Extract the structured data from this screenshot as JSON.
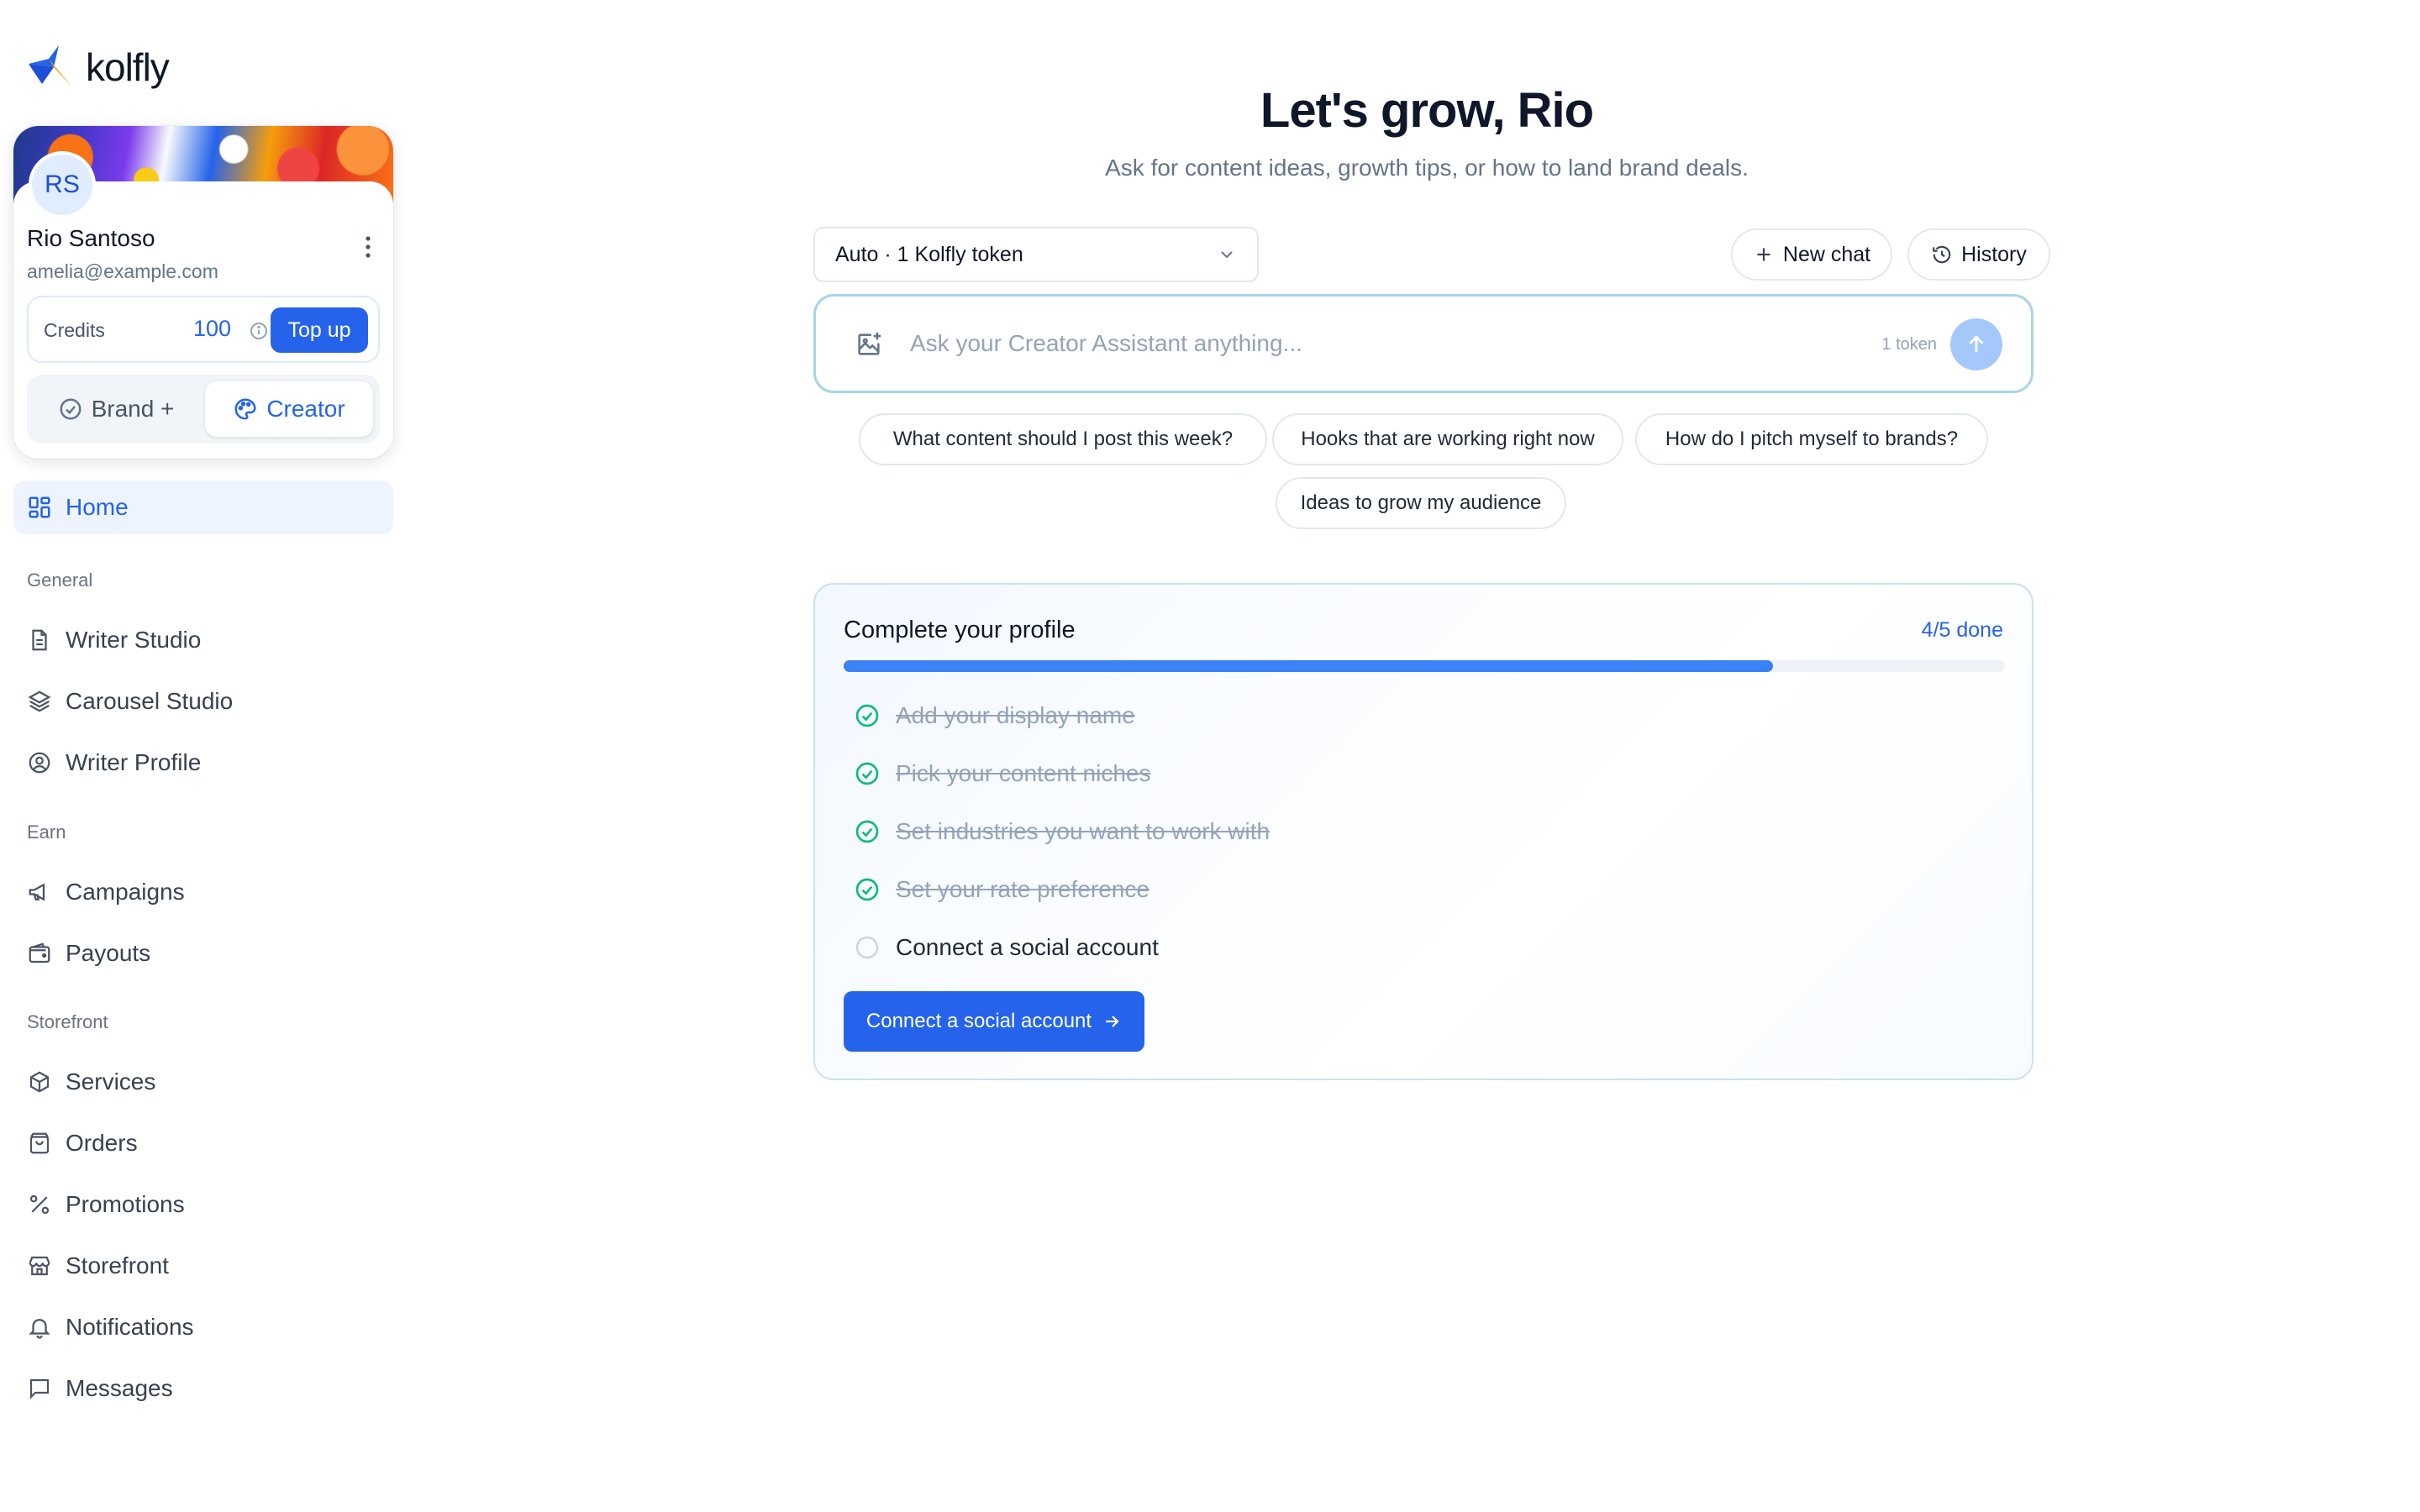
{
  "app": {
    "logo_text": "kolfly"
  },
  "user": {
    "initials": "RS",
    "name": "Rio Santoso",
    "email": "amelia@example.com"
  },
  "credits": {
    "label": "Credits",
    "value": "100",
    "topup_label": "Top up"
  },
  "mode_switch": {
    "brand_label": "Brand +",
    "creator_label": "Creator",
    "active": "creator"
  },
  "nav": {
    "home": "Home",
    "sections": [
      {
        "label": "General",
        "items": [
          "Writer Studio",
          "Carousel Studio",
          "Writer Profile"
        ]
      },
      {
        "label": "Earn",
        "items": [
          "Campaigns",
          "Payouts"
        ]
      },
      {
        "label": "Storefront",
        "items": [
          "Services",
          "Orders",
          "Promotions",
          "Storefront",
          "Notifications",
          "Messages"
        ]
      }
    ]
  },
  "main": {
    "title": "Let's grow, Rio",
    "subtitle": "Ask for content ideas, growth tips, or how to land brand deals.",
    "model_select": "Auto · 1 Kolfly token",
    "new_chat_label": "New chat",
    "history_label": "History",
    "chat_placeholder": "Ask your Creator Assistant anything...",
    "token_hint": "1 token",
    "suggestions": [
      "What content should I post this week?",
      "Hooks that are working right now",
      "How do I pitch myself to brands?",
      "Ideas to grow my audience"
    ]
  },
  "profile_panel": {
    "title": "Complete your profile",
    "progress_text": "4/5 done",
    "progress_fraction": 0.8,
    "tasks": [
      {
        "label": "Add your display name",
        "done": true
      },
      {
        "label": "Pick your content niches",
        "done": true
      },
      {
        "label": "Set industries you want to work with",
        "done": true
      },
      {
        "label": "Set your rate preference",
        "done": true
      },
      {
        "label": "Connect a social account",
        "done": false
      }
    ],
    "cta_label": "Connect a social account"
  },
  "colors": {
    "accent": "#2563eb",
    "success": "#10b981",
    "muted": "#94a3b8"
  }
}
